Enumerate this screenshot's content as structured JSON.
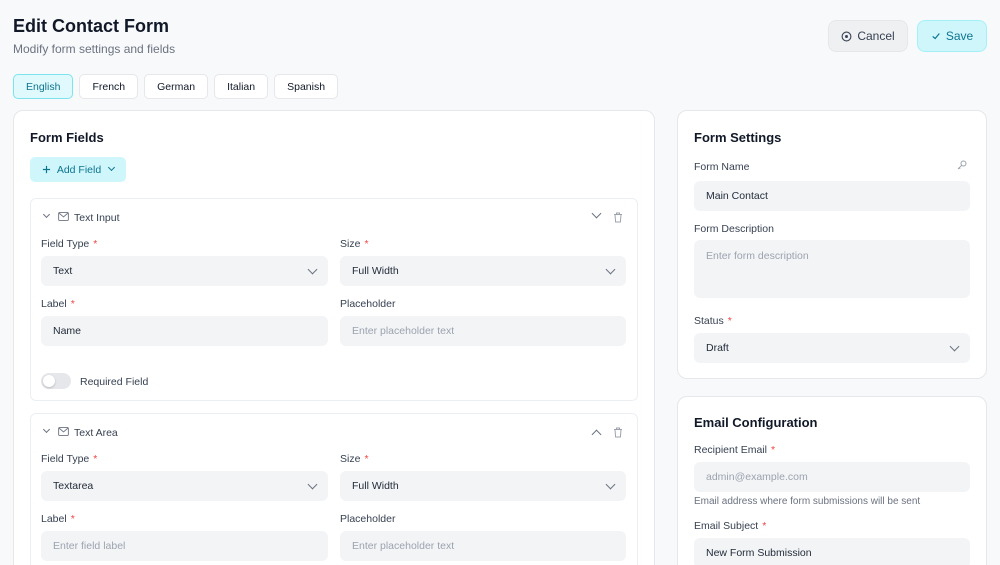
{
  "header": {
    "title": "Edit Contact Form",
    "subtitle": "Modify form settings and fields",
    "cancel_label": "Cancel",
    "save_label": "Save"
  },
  "languages": [
    "English",
    "French",
    "German",
    "Italian",
    "Spanish"
  ],
  "active_language": "English",
  "form_fields": {
    "title": "Form Fields",
    "add_field_label": "Add Field",
    "fields": [
      {
        "type_title": "Text Input",
        "field_type_label": "Field Type",
        "field_type_value": "Text",
        "size_label": "Size",
        "size_value": "Full Width",
        "label_label": "Label",
        "label_value": "Name",
        "placeholder_label": "Placeholder",
        "placeholder_placeholder": "Enter placeholder text",
        "required_label": "Required Field"
      },
      {
        "type_title": "Text Area",
        "field_type_label": "Field Type",
        "field_type_value": "Textarea",
        "size_label": "Size",
        "size_value": "Full Width",
        "label_label": "Label",
        "label_placeholder": "Enter field label",
        "placeholder_label": "Placeholder",
        "placeholder_placeholder": "Enter placeholder text"
      }
    ]
  },
  "form_settings": {
    "title": "Form Settings",
    "name_label": "Form Name",
    "name_value": "Main Contact",
    "description_label": "Form Description",
    "description_placeholder": "Enter form description",
    "status_label": "Status",
    "status_value": "Draft"
  },
  "email_config": {
    "title": "Email Configuration",
    "recipient_label": "Recipient Email",
    "recipient_placeholder": "admin@example.com",
    "recipient_hint": "Email address where form submissions will be sent",
    "subject_label": "Email Subject",
    "subject_value": "New Form Submission"
  },
  "colors": {
    "accent": "#0e7490",
    "accent_bg": "#cff7fb",
    "required": "#ef4444"
  }
}
